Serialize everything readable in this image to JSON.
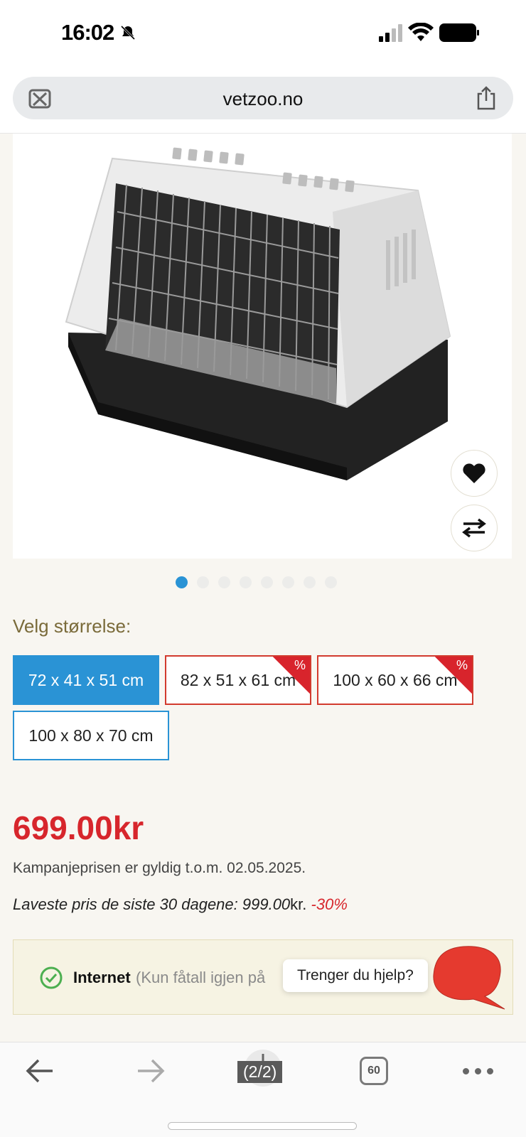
{
  "status_bar": {
    "time": "16:02"
  },
  "browser": {
    "url": "vetzoo.no"
  },
  "product": {
    "image_count": 8,
    "active_image": 1,
    "size_label": "Velg størrelse:",
    "sizes": [
      {
        "label": "72 x 41 x 51 cm",
        "state": "selected"
      },
      {
        "label": "82 x 51 x 61 cm",
        "state": "sale",
        "badge": "%"
      },
      {
        "label": "100 x 60 x 66 cm",
        "state": "sale",
        "badge": "%"
      },
      {
        "label": "100 x 80 x 70 cm",
        "state": "available"
      }
    ],
    "price": "699.00kr",
    "campaign_text": "Kampanjeprisen er gyldig t.o.m. 02.05.2025.",
    "lowest_price_label": "Laveste pris de siste 30 dagene: 999.00",
    "lowest_price_currency": "kr.",
    "discount": "-30%"
  },
  "stock": {
    "channel": "Internet",
    "note": "(Kun fåtall igjen på"
  },
  "chat": {
    "help_text": "Trenger du hjelp?"
  },
  "bottom_bar": {
    "page_counter": "(2/2)",
    "tab_count": "60"
  },
  "colors": {
    "accent_blue": "#2a93d5",
    "sale_red": "#d7262c",
    "background": "#f8f6f1"
  },
  "icons": [
    "bell-slash-icon",
    "signal-icon",
    "wifi-icon",
    "battery-icon",
    "tab-close-icon",
    "share-icon",
    "heart-icon",
    "compare-icon",
    "check-circle-icon",
    "chat-icon",
    "back-arrow-icon",
    "forward-arrow-icon",
    "download-icon",
    "tabs-icon",
    "more-icon"
  ]
}
